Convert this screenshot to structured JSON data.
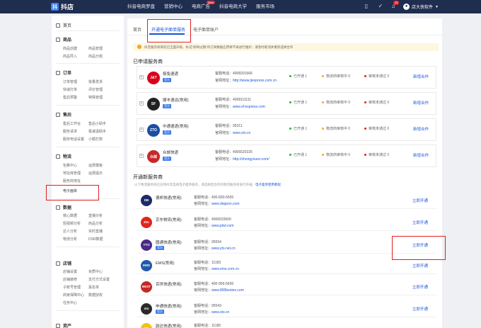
{
  "header": {
    "logo_glyph": "抖",
    "app_title": "抖店",
    "nav": [
      "抖音电商罗盘",
      "营销中心",
      "电商广告",
      "抖音电商大学",
      "服务市场"
    ],
    "hot_badge": "New",
    "msg_count": "15",
    "user_name": "店大侠软件"
  },
  "sidebar": {
    "home": "首页",
    "sections": [
      {
        "title": "商品",
        "items": [
          "商品创建",
          "商品管理",
          "商品导入",
          "商品分组"
        ]
      },
      {
        "title": "订单",
        "items": [
          "订单管理",
          "批量发货",
          "快递打单",
          "评价管理",
          "售后预警",
          "特殊管理"
        ]
      },
      {
        "title": "售后",
        "items": [
          "售后工作台",
          "售后小助手",
          "服务请求",
          "极速退助手",
          "服务电话设置",
          "小额打款"
        ]
      },
      {
        "title": "物流",
        "items": [
          "包裹中心",
          "运费模板",
          "地址库管理",
          "运费提示",
          "服务商地址",
          "电子面单"
        ]
      },
      {
        "title": "数据",
        "items": [
          "核心数据",
          "直播分析",
          "短视频分析",
          "商品分析",
          "达人分析",
          "实时直播",
          "物流分析",
          "DSR数据"
        ]
      },
      {
        "title": "店铺",
        "items": [
          "店铺设置",
          "资质中心",
          "店铺装修",
          "支付方式设置",
          "子账号管理",
          "黑名单",
          "商家保障中心",
          "数据授权",
          "任务中心"
        ]
      },
      {
        "title": "资产",
        "items": []
      }
    ]
  },
  "tabs": [
    "首页",
    "开通电子面单服务",
    "电子面单账户"
  ],
  "notice": "抖音服务商目前已全面升级，标记\"即将过期\"的订阅数据应用将不再进行维护，请及时取消并重新选择合作",
  "applied_title": "已申请服务商",
  "applied": [
    {
      "name": "极兔速递",
      "tag": "官方",
      "phone": "客服电话：4008201666",
      "site_label": "官网地址：",
      "site": "http://www.jtexpress.com.cn",
      "logo_text": "J&T",
      "logo_color": "#d9001b"
    },
    {
      "name": "顺丰速运(常用)",
      "tag": "官方",
      "phone": "客服电话：4008111111",
      "site_label": "官网地址：",
      "site": "www.sf-express.com",
      "logo_text": "SF",
      "logo_color": "#222222"
    },
    {
      "name": "中通速递(常用)",
      "tag": "官方",
      "phone": "客服电话：95311",
      "site_label": "官网地址：",
      "site": "www.zto.cn",
      "logo_text": "ZTO",
      "logo_color": "#1b4fa3"
    },
    {
      "name": "众邮快递",
      "tag": "官方",
      "phone": "客服电话：4006520226",
      "site_label": "官网地址：",
      "site": "http://zhongyouex.com/",
      "logo_text": "众邮",
      "logo_color": "#c62828"
    }
  ],
  "status_labels": {
    "opened": "已开通 1",
    "review": "物流商审核中 0",
    "rejected": "审核未通过 0"
  },
  "status_colors": {
    "opened": "#22b14c",
    "review": "#f5a623",
    "rejected": "#e02020"
  },
  "add_coop": "新增合作",
  "new_title": "开通新服务商",
  "new_sub": "以下物流服务商已支持抖音电商电子面单服务，请选择您合作的物流服务商进行开通。",
  "new_sub_link": "电子面单使用教程",
  "providers": [
    {
      "name": "德邦快递(常用)",
      "tag": "",
      "phone": "客服电话：400-830-5555",
      "site_label": "官网地址：",
      "site": "www.deppon.com",
      "logo_text": "DB",
      "logo_color": "#1d2a6b"
    },
    {
      "name": "京东物流(常用)",
      "tag": "",
      "phone": "客服电话：4006033600",
      "site_label": "官网地址：",
      "site": "www.jdwl.com",
      "logo_text": "JDL",
      "logo_color": "#e1251b"
    },
    {
      "name": "圆通快递(常用)",
      "tag": "官方",
      "phone": "客服电话：95554",
      "site_label": "官网地址：",
      "site": "www.yto.net.cn",
      "logo_text": "YTO",
      "logo_color": "#4b2a86"
    },
    {
      "name": "EMS(常用)",
      "tag": "",
      "phone": "客服电话：11183",
      "site_label": "官网地址：",
      "site": "www.ems.com.cn",
      "logo_text": "EMS",
      "logo_color": "#1e5aa8"
    },
    {
      "name": "百世快递(常用)",
      "tag": "",
      "phone": "客服电话：400-956-5656",
      "site_label": "官网地址：",
      "site": "www.800bestex.com",
      "logo_text": "BEST",
      "logo_color": "#c62828"
    },
    {
      "name": "申通快递(常用)",
      "tag": "官方",
      "phone": "客服电话：95543",
      "site_label": "官网地址：",
      "site": "www.sto.cn",
      "logo_text": "sto",
      "logo_color": "#2a2a2a"
    },
    {
      "name": "韵达快递(常用)",
      "tag": "",
      "phone": "客服电话：11185",
      "site_label": "",
      "site": "",
      "logo_text": "YD",
      "logo_color": "#f1c40f"
    }
  ],
  "open_label": "立即开通"
}
